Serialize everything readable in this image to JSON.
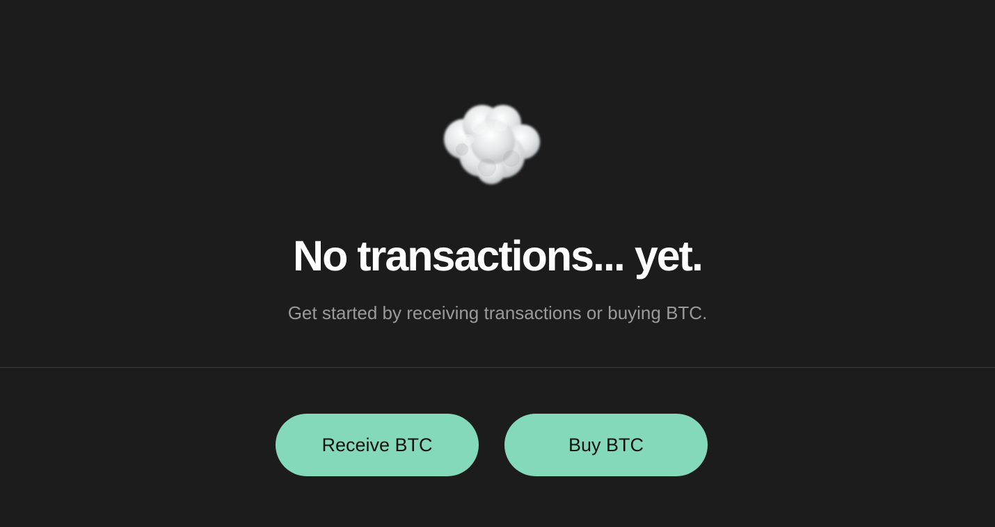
{
  "empty_state": {
    "icon": "cloud-icon",
    "title": "No transactions... yet.",
    "subtitle": "Get started by receiving transactions or buying BTC."
  },
  "actions": {
    "receive_label": "Receive BTC",
    "buy_label": "Buy BTC"
  },
  "colors": {
    "background": "#1c1c1c",
    "title_text": "#ffffff",
    "subtitle_text": "#9a9a9a",
    "divider": "#3b3b3b",
    "button_fill": "#85d9bb",
    "button_text": "#111111"
  }
}
